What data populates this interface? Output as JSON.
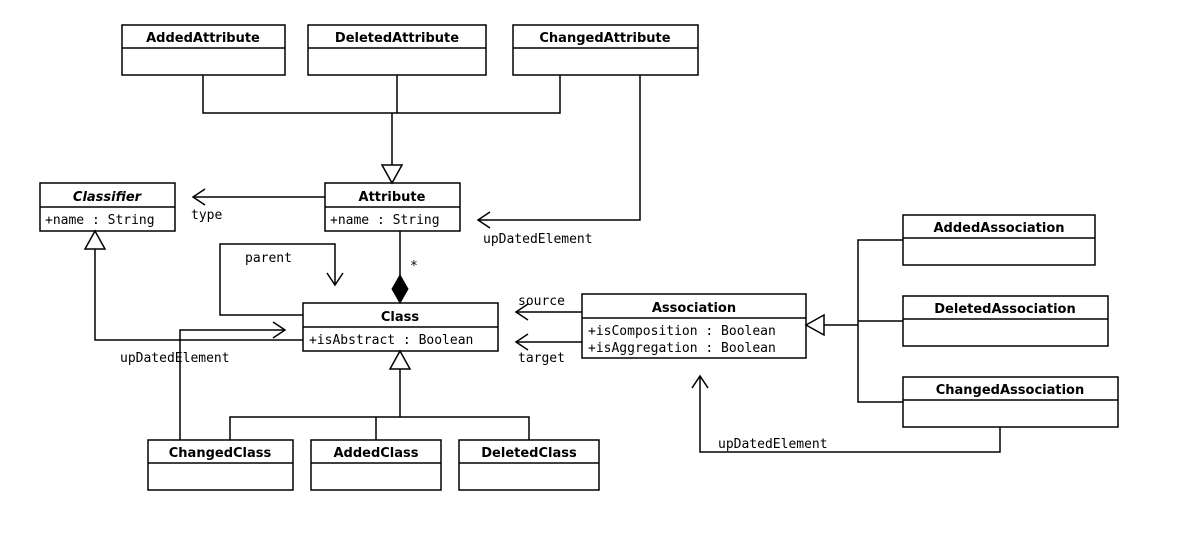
{
  "classes": {
    "addedAttribute": {
      "name": "AddedAttribute",
      "attrs": []
    },
    "deletedAttribute": {
      "name": "DeletedAttribute",
      "attrs": []
    },
    "changedAttribute": {
      "name": "ChangedAttribute",
      "attrs": []
    },
    "classifier": {
      "name": "Classifier",
      "attrs": [
        "+name : String"
      ],
      "abstract": true
    },
    "attribute": {
      "name": "Attribute",
      "attrs": [
        "+name : String"
      ]
    },
    "class": {
      "name": "Class",
      "attrs": [
        "+isAbstract : Boolean"
      ]
    },
    "association": {
      "name": "Association",
      "attrs": [
        "+isComposition : Boolean",
        "+isAggregation : Boolean"
      ]
    },
    "changedClass": {
      "name": "ChangedClass",
      "attrs": []
    },
    "addedClass": {
      "name": "AddedClass",
      "attrs": []
    },
    "deletedClass": {
      "name": "DeletedClass",
      "attrs": []
    },
    "addedAssociation": {
      "name": "AddedAssociation",
      "attrs": []
    },
    "deletedAssociation": {
      "name": "DeletedAssociation",
      "attrs": []
    },
    "changedAssociation": {
      "name": "ChangedAssociation",
      "attrs": []
    }
  },
  "labels": {
    "type": "type",
    "parent": "parent",
    "upDatedElement": "upDatedElement",
    "source": "source",
    "target": "target",
    "star": "*"
  }
}
